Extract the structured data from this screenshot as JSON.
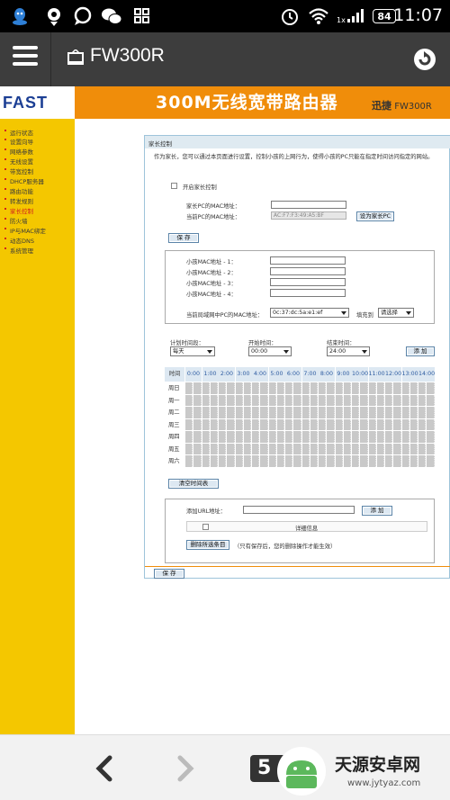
{
  "status_bar": {
    "battery": "84",
    "time": "11:07",
    "network_label": "1x"
  },
  "app_bar": {
    "title": "FW300R"
  },
  "banner": {
    "logo": "FAST",
    "title": "300M无线宽带路由器",
    "brand": "迅捷",
    "model": "FW300R"
  },
  "sidebar": {
    "items": [
      {
        "label": "运行状态",
        "active": false
      },
      {
        "label": "设置向导",
        "active": false
      },
      {
        "label": "网络参数",
        "active": false
      },
      {
        "label": "无线设置",
        "active": false
      },
      {
        "label": "带宽控制",
        "active": false
      },
      {
        "label": "DHCP服务器",
        "active": false
      },
      {
        "label": "路由功能",
        "active": false
      },
      {
        "label": "转发规则",
        "active": false
      },
      {
        "label": "家长控制",
        "active": true
      },
      {
        "label": "防火墙",
        "active": false
      },
      {
        "label": "IP与MAC绑定",
        "active": false
      },
      {
        "label": "动态DNS",
        "active": false
      },
      {
        "label": "系统管理",
        "active": false
      }
    ]
  },
  "panel": {
    "title": "家长控制",
    "description": "作为家长，您可以通过本页面进行设置，控制小孩的上网行为，使得小孩的PC只能在指定时间访问指定的网站。",
    "enable_label": "开启家长控制",
    "enable_checked": false,
    "parent_mac_label": "家长PC的MAC地址：",
    "parent_mac_value": "",
    "current_mac_label": "当前PC的MAC地址：",
    "current_mac_value": "AC:F7:F3:49:A5:BF",
    "set_parent_button": "设为家长PC",
    "save_button": "保 存",
    "child_mac_labels": [
      "小孩MAC地址 - 1：",
      "小孩MAC地址 - 2：",
      "小孩MAC地址 - 3：",
      "小孩MAC地址 - 4："
    ],
    "lan_mac_label": "当前局域网中PC的MAC地址：",
    "lan_mac_value": "0c:37:dc:5a:e1:ef",
    "fill_to_label": "填充到",
    "fill_to_value": "请选择",
    "plan_label": "计划时间段：",
    "plan_value": "每天",
    "start_label": "开始时间：",
    "start_value": "00:00",
    "end_label": "结束时间：",
    "end_value": "24:00",
    "add_button": "添 加",
    "time_header_label": "时间",
    "hours": [
      "0:00",
      "1:00",
      "2:00",
      "3:00",
      "4:00",
      "5:00",
      "6:00",
      "7:00",
      "8:00",
      "9:00",
      "10:00",
      "11:00",
      "12:00",
      "13:00",
      "14:00"
    ],
    "days": [
      "周日",
      "周一",
      "周二",
      "周三",
      "周四",
      "周五",
      "周六"
    ],
    "clear_schedule_button": "清空时间表",
    "add_url_label": "添加URL地址：",
    "url_value": "",
    "add_url_button": "添 加",
    "details_header": "详细信息",
    "delete_all_button": "删除所选条目",
    "delete_note": "（只有保存后，您的删除操作才能生效）",
    "bottom_save_button": "保 存"
  },
  "browser_nav": {
    "tab_count": "5"
  },
  "watermark": {
    "title": "天源安卓网",
    "url": "www.jytyaz.com"
  },
  "colors": {
    "banner_orange": "#f08d0a",
    "sidebar_yellow": "#f4c700",
    "active_red": "#d02020",
    "logo_blue": "#1c3f94"
  }
}
